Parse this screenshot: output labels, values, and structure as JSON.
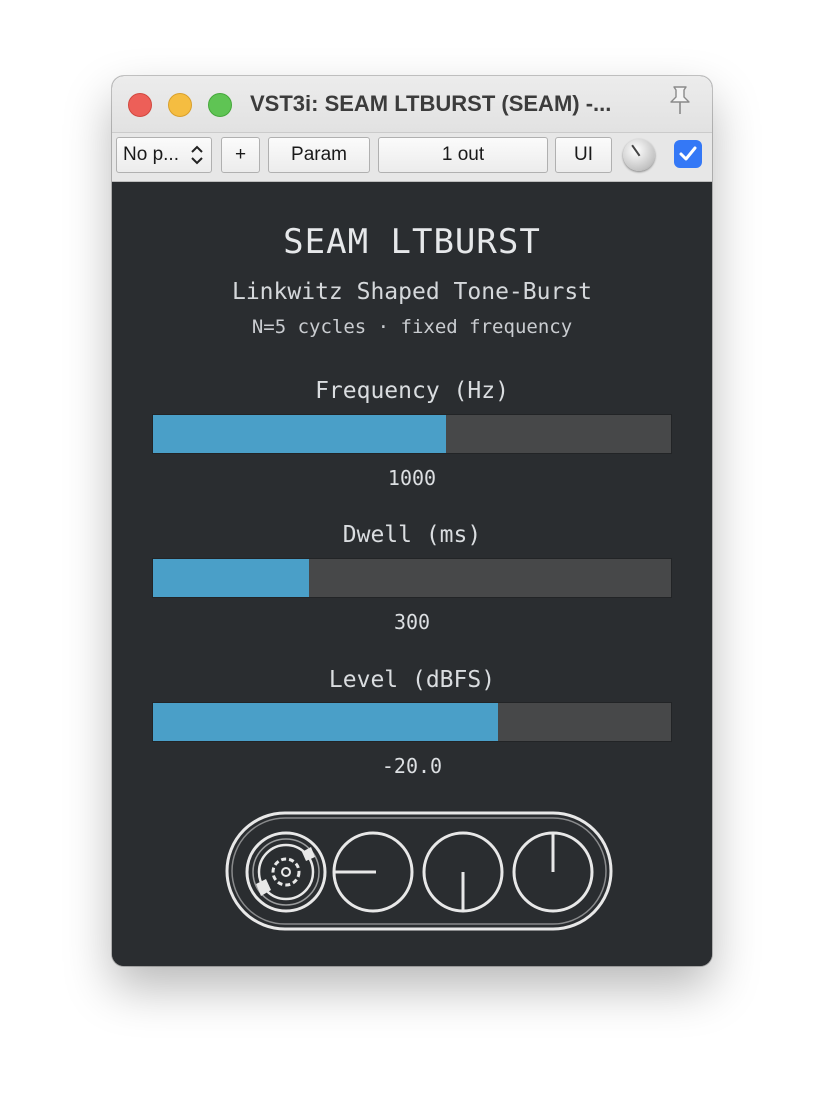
{
  "window": {
    "title": "VST3i: SEAM LTBURST (SEAM) -...",
    "traffic_lights": [
      "close",
      "minimize",
      "zoom"
    ]
  },
  "toolbar": {
    "preset_label": "No p...",
    "add_label": "+",
    "param_label": "Param",
    "io_label": "1 out",
    "ui_label": "UI",
    "enabled": true
  },
  "plugin": {
    "title": "SEAM LTBURST",
    "subtitle": "Linkwitz Shaped Tone-Burst",
    "note": "N=5 cycles · fixed frequency",
    "params": [
      {
        "label": "Frequency (Hz)",
        "value": "1000",
        "fraction": 0.566
      },
      {
        "label": "Dwell (ms)",
        "value": "300",
        "fraction": 0.302
      },
      {
        "label": "Level (dBFS)",
        "value": "-20.0",
        "fraction": 0.666
      }
    ]
  },
  "colors": {
    "panel_bg": "#2a2d30",
    "bar_track": "#474849",
    "bar_fill": "#4a9fc8",
    "text": "#e6e8ea"
  },
  "icons": [
    "pin-icon",
    "chevron-updown-icon",
    "checkmark-icon",
    "reel-logo-icon",
    "logo-circle-left-icon",
    "logo-circle-down-icon",
    "logo-circle-up-icon"
  ]
}
